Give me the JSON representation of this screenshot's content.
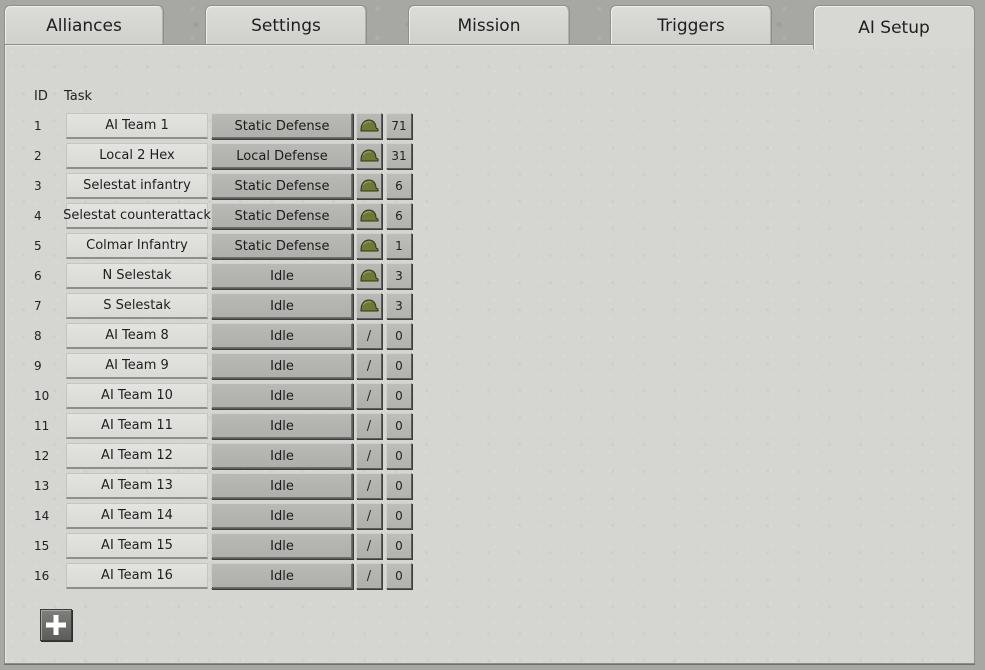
{
  "tabs": [
    {
      "label": "Alliances",
      "active": false
    },
    {
      "label": "Settings",
      "active": false
    },
    {
      "label": "Mission",
      "active": false
    },
    {
      "label": "Triggers",
      "active": false
    },
    {
      "label": "AI Setup",
      "active": true
    }
  ],
  "table": {
    "headers": {
      "id": "ID",
      "task": "Task"
    },
    "rows": [
      {
        "id": "1",
        "name": "AI Team 1",
        "task": "Static Defense",
        "icon": "helmet-icon",
        "count": "71"
      },
      {
        "id": "2",
        "name": "Local 2 Hex",
        "task": "Local Defense",
        "icon": "helmet-icon",
        "count": "31"
      },
      {
        "id": "3",
        "name": "Selestat infantry",
        "task": "Static Defense",
        "icon": "helmet-icon",
        "count": "6"
      },
      {
        "id": "4",
        "name": "Selestat counterattack",
        "task": "Static Defense",
        "icon": "helmet-icon",
        "count": "6"
      },
      {
        "id": "5",
        "name": "Colmar Infantry",
        "task": "Static Defense",
        "icon": "helmet-icon",
        "count": "1"
      },
      {
        "id": "6",
        "name": "N Selestak",
        "task": "Idle",
        "icon": "helmet-icon",
        "count": "3"
      },
      {
        "id": "7",
        "name": "S Selestak",
        "task": "Idle",
        "icon": "helmet-icon",
        "count": "3"
      },
      {
        "id": "8",
        "name": "AI Team 8",
        "task": "Idle",
        "icon": "slash-icon",
        "count": "0"
      },
      {
        "id": "9",
        "name": "AI Team 9",
        "task": "Idle",
        "icon": "slash-icon",
        "count": "0"
      },
      {
        "id": "10",
        "name": "AI Team 10",
        "task": "Idle",
        "icon": "slash-icon",
        "count": "0"
      },
      {
        "id": "11",
        "name": "AI Team 11",
        "task": "Idle",
        "icon": "slash-icon",
        "count": "0"
      },
      {
        "id": "12",
        "name": "AI Team 12",
        "task": "Idle",
        "icon": "slash-icon",
        "count": "0"
      },
      {
        "id": "13",
        "name": "AI Team 13",
        "task": "Idle",
        "icon": "slash-icon",
        "count": "0"
      },
      {
        "id": "14",
        "name": "AI Team 14",
        "task": "Idle",
        "icon": "slash-icon",
        "count": "0"
      },
      {
        "id": "15",
        "name": "AI Team 15",
        "task": "Idle",
        "icon": "slash-icon",
        "count": "0"
      },
      {
        "id": "16",
        "name": "AI Team 16",
        "task": "Idle",
        "icon": "slash-icon",
        "count": "0"
      }
    ],
    "slash_glyph": "/"
  },
  "add_button": {
    "icon": "plus-icon"
  },
  "colors": {
    "helmet": "#6b7a34",
    "panel": "#d5d5d2",
    "task_button": "#b4b4b1"
  }
}
